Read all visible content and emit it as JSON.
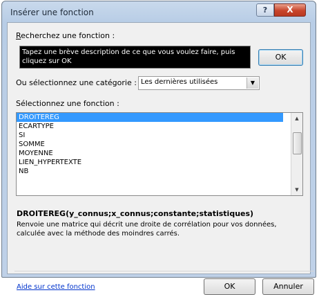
{
  "window": {
    "title": "Insérer une fonction",
    "help_label": "?",
    "close_label": "X"
  },
  "search": {
    "label_prefix": "R",
    "label_rest": "echerchez une fonction :",
    "value": "Tapez une brève description de ce que vous voulez faire, puis cliquez sur OK",
    "ok_label": "OK"
  },
  "category": {
    "label": "Ou sélectionnez une catégorie :",
    "selected": "Les dernières utilisées",
    "arrow": "▼"
  },
  "functions": {
    "label": "Sélectionnez une fonction :",
    "items": [
      "DROITEREG",
      "ECARTYPE",
      "SI",
      "SOMME",
      "MOYENNE",
      "LIEN_HYPERTEXTE",
      "NB"
    ],
    "selected_index": 0
  },
  "details": {
    "syntax": "DROITEREG(y_connus;x_connus;constante;statistiques)",
    "description": "Renvoie une matrice qui décrit une droite de corrélation pour vos données, calculée avec la méthode des moindres carrés."
  },
  "footer": {
    "help_link": "Aide sur cette fonction",
    "ok_label": "OK",
    "cancel_label": "Annuler"
  }
}
